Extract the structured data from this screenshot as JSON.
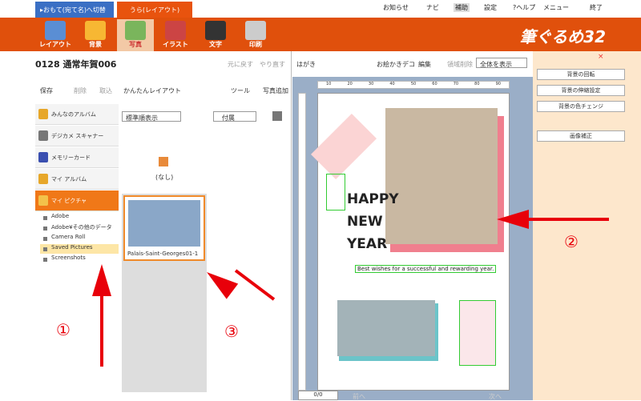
{
  "tabs": {
    "front": "▸おもて(宛て名)へ切替",
    "back": "うら(レイアウト)"
  },
  "toplinks": {
    "notice": "お知らせ",
    "navi": "ナビ",
    "assist": "補助",
    "settings": "設定",
    "help": "?ヘルプ",
    "menu": "メニュー",
    "exit": "終了"
  },
  "toolbar": {
    "layout": "レイアウト",
    "background": "背景",
    "photo": "写真",
    "illust": "イラスト",
    "text": "文字",
    "print": "印刷",
    "brand": "筆ぐるめ32"
  },
  "document": {
    "title": "0128 通常年賀006",
    "undo": "元に戻す",
    "redo": "やり直す",
    "save": "保存",
    "delete": "削除",
    "import": "取込",
    "easy_layout": "かんたんレイアウト",
    "tools": "ツール",
    "add_photo": "写真追加"
  },
  "sidebar": {
    "items": [
      "みんなのアルバム",
      "デジカメ スキャナー",
      "メモリーカード",
      "マイ アルバム",
      "マイ ピクチャ"
    ],
    "subfolders": [
      "Adobe",
      "Adobe¥その他のデータ",
      "Camera Roll",
      "Saved Pictures",
      "Screenshots"
    ]
  },
  "thumbs": {
    "sort": "標準順表示",
    "attach": "付属",
    "none": "(なし)",
    "photo_name": "Palais-Saint-Georges01-1"
  },
  "canvas": {
    "postcard": "はがき",
    "deco": "お絵かきデコ",
    "edit": "編集",
    "select_delete": "領域削除",
    "view": "全体を表示",
    "happy": "HAPPY",
    "new": "NEW",
    "year": "YEAR",
    "wishes": "Best wishes for a successful and rewarding year.",
    "page": "0/0",
    "prev": "前へ",
    "next": "次へ"
  },
  "rpanel": {
    "rotate": "背景の回転",
    "stretch": "背景の伸縮設定",
    "color": "背景の色チェンジ",
    "correct": "画像補正"
  },
  "annotations": {
    "n1": "①",
    "n2": "②",
    "n3": "③"
  },
  "ruler": {
    "h": [
      "10",
      "20",
      "30",
      "40",
      "50",
      "60",
      "70",
      "80",
      "90"
    ]
  }
}
